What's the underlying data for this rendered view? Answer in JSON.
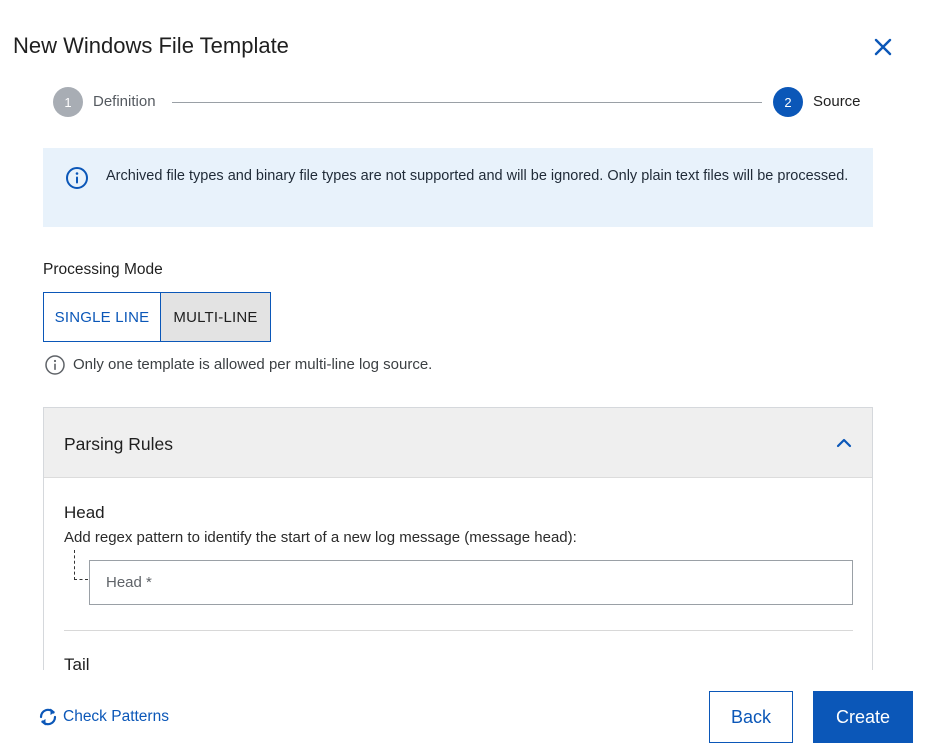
{
  "dialog": {
    "title": "New Windows File Template",
    "close_icon": "close-icon"
  },
  "stepper": {
    "steps": [
      {
        "number": "1",
        "label": "Definition",
        "state": "completed"
      },
      {
        "number": "2",
        "label": "Source",
        "state": "active"
      }
    ]
  },
  "banner": {
    "icon": "info-icon",
    "text": "Archived file types and binary file types are not supported and will be ignored. Only plain text files will be processed."
  },
  "processing_mode": {
    "label": "Processing Mode",
    "options": [
      "SINGLE LINE",
      "MULTI-LINE"
    ],
    "selected": "MULTI-LINE",
    "hint": "Only one template is allowed per multi-line log source."
  },
  "parsing_rules": {
    "title": "Parsing Rules",
    "expanded": true,
    "head": {
      "label": "Head",
      "description": "Add regex pattern to identify the start of a new log message (message head):",
      "placeholder": "Head *",
      "value": ""
    },
    "tail": {
      "label": "Tail"
    }
  },
  "footer": {
    "check_patterns_label": "Check Patterns",
    "back_label": "Back",
    "create_label": "Create"
  },
  "colors": {
    "primary": "#0b57b8",
    "banner_bg": "#e8f2fb",
    "step_inactive": "#a8adb4",
    "accordion_header_bg": "#efefef"
  }
}
